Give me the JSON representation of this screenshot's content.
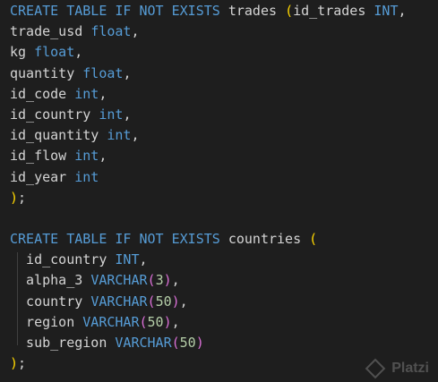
{
  "editor": {
    "lines": [
      [
        {
          "t": "CREATE TABLE IF NOT EXISTS",
          "c": "kw"
        },
        {
          "t": " trades ",
          "c": "pl"
        },
        {
          "t": "(",
          "c": "p1"
        },
        {
          "t": "id_trades ",
          "c": "pl"
        },
        {
          "t": "INT",
          "c": "kw"
        },
        {
          "t": ",",
          "c": "pl"
        }
      ],
      [
        {
          "t": "trade_usd ",
          "c": "pl"
        },
        {
          "t": "float",
          "c": "kw"
        },
        {
          "t": ",",
          "c": "pl"
        }
      ],
      [
        {
          "t": "kg ",
          "c": "pl"
        },
        {
          "t": "float",
          "c": "kw"
        },
        {
          "t": ",",
          "c": "pl"
        }
      ],
      [
        {
          "t": "quantity ",
          "c": "pl"
        },
        {
          "t": "float",
          "c": "kw"
        },
        {
          "t": ",",
          "c": "pl"
        }
      ],
      [
        {
          "t": "id_code ",
          "c": "pl"
        },
        {
          "t": "int",
          "c": "kw"
        },
        {
          "t": ",",
          "c": "pl"
        }
      ],
      [
        {
          "t": "id_country ",
          "c": "pl"
        },
        {
          "t": "int",
          "c": "kw"
        },
        {
          "t": ",",
          "c": "pl"
        }
      ],
      [
        {
          "t": "id_quantity ",
          "c": "pl"
        },
        {
          "t": "int",
          "c": "kw"
        },
        {
          "t": ",",
          "c": "pl"
        }
      ],
      [
        {
          "t": "id_flow ",
          "c": "pl"
        },
        {
          "t": "int",
          "c": "kw"
        },
        {
          "t": ",",
          "c": "pl"
        }
      ],
      [
        {
          "t": "id_year ",
          "c": "pl"
        },
        {
          "t": "int",
          "c": "kw"
        }
      ],
      [
        {
          "t": ")",
          "c": "p1"
        },
        {
          "t": ";",
          "c": "pl"
        }
      ],
      [],
      [
        {
          "t": "CREATE TABLE IF NOT EXISTS",
          "c": "kw"
        },
        {
          "t": " countries ",
          "c": "pl"
        },
        {
          "t": "(",
          "c": "p1"
        }
      ],
      [
        {
          "t": "  id_country ",
          "c": "pl"
        },
        {
          "t": "INT",
          "c": "kw"
        },
        {
          "t": ",",
          "c": "pl"
        }
      ],
      [
        {
          "t": "  alpha_3 ",
          "c": "pl"
        },
        {
          "t": "VARCHAR",
          "c": "kw"
        },
        {
          "t": "(",
          "c": "p2"
        },
        {
          "t": "3",
          "c": "num"
        },
        {
          "t": ")",
          "c": "p2"
        },
        {
          "t": ",",
          "c": "pl"
        }
      ],
      [
        {
          "t": "  country ",
          "c": "pl"
        },
        {
          "t": "VARCHAR",
          "c": "kw"
        },
        {
          "t": "(",
          "c": "p2"
        },
        {
          "t": "50",
          "c": "num"
        },
        {
          "t": ")",
          "c": "p2"
        },
        {
          "t": ",",
          "c": "pl"
        }
      ],
      [
        {
          "t": "  region ",
          "c": "pl"
        },
        {
          "t": "VARCHAR",
          "c": "kw"
        },
        {
          "t": "(",
          "c": "p2"
        },
        {
          "t": "50",
          "c": "num"
        },
        {
          "t": ")",
          "c": "p2"
        },
        {
          "t": ",",
          "c": "pl"
        }
      ],
      [
        {
          "t": "  sub_region ",
          "c": "pl"
        },
        {
          "t": "VARCHAR",
          "c": "kw"
        },
        {
          "t": "(",
          "c": "p2"
        },
        {
          "t": "50",
          "c": "num"
        },
        {
          "t": ")",
          "c": "p2"
        }
      ],
      [
        {
          "t": ")",
          "c": "p1"
        },
        {
          "t": ";",
          "c": "pl"
        }
      ]
    ]
  },
  "watermark": {
    "text": "Platzi",
    "icon": "platzi-logo-icon"
  },
  "colors": {
    "background": "#1e1e1e",
    "keyword": "#569cd6",
    "plain": "#d4d4d4",
    "number": "#b5cea8",
    "bracket_level_1": "#ffd700",
    "bracket_level_2": "#da70d6"
  }
}
